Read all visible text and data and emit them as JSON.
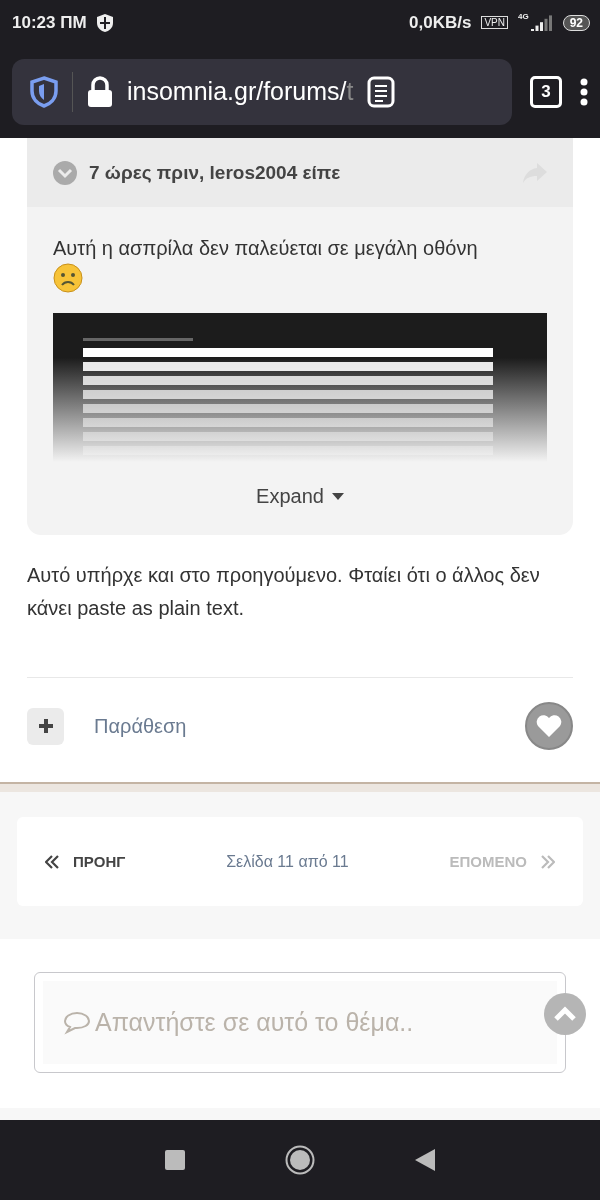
{
  "status_bar": {
    "time": "10:23 ΠΜ",
    "speed": "0,0KB/s",
    "vpn": "VPN",
    "network": "4G",
    "battery": "92"
  },
  "browser": {
    "url_host": "insomnia.gr/forums/",
    "url_rest": "t",
    "tab_count": "3"
  },
  "quote": {
    "header": "7 ώρες πριν, leros2004 είπε",
    "text": "Αυτή η ασπρίλα δεν παλεύεται σε μεγάλη οθόνη",
    "expand": "Expand"
  },
  "post": {
    "text": "Αυτό υπήρχε και στο προηγούμενο. Φταίει ότι ο άλλος δεν κάνει paste as plain text.",
    "quote_action": "Παράθεση",
    "liked": false
  },
  "pagination": {
    "prev": {
      "label": "ΠΡΟΗΓ",
      "disabled": false
    },
    "page": "Σελίδα 11 από 11",
    "next": {
      "label": "ΕΠΟΜΕΝΟ",
      "disabled": true
    }
  },
  "reply": {
    "placeholder": "Απαντήστε σε αυτό το θέμα.."
  }
}
